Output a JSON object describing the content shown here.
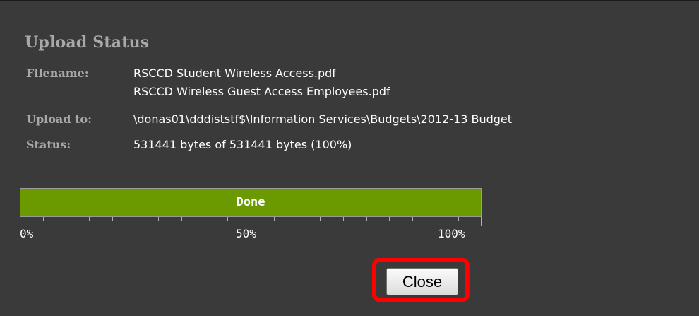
{
  "dialog": {
    "title": "Upload Status",
    "fields": {
      "filename_label": "Filename:",
      "filenames": [
        "RSCCD Student Wireless Access.pdf",
        "RSCCD Wireless Guest Access Employees.pdf"
      ],
      "upload_to_label": "Upload to:",
      "upload_to": "\\donas01\\dddiststf$\\Information Services\\Budgets\\2012-13 Budget",
      "status_label": "Status:",
      "status": "531441 bytes of 531441 bytes (100%)"
    },
    "progress": {
      "value_percent": 100,
      "text": "Done",
      "fill_color": "#6a9a00",
      "scale_labels": [
        "0%",
        "50%",
        "100%"
      ]
    },
    "close_label": "Close",
    "highlight_color": "#ff0000"
  }
}
